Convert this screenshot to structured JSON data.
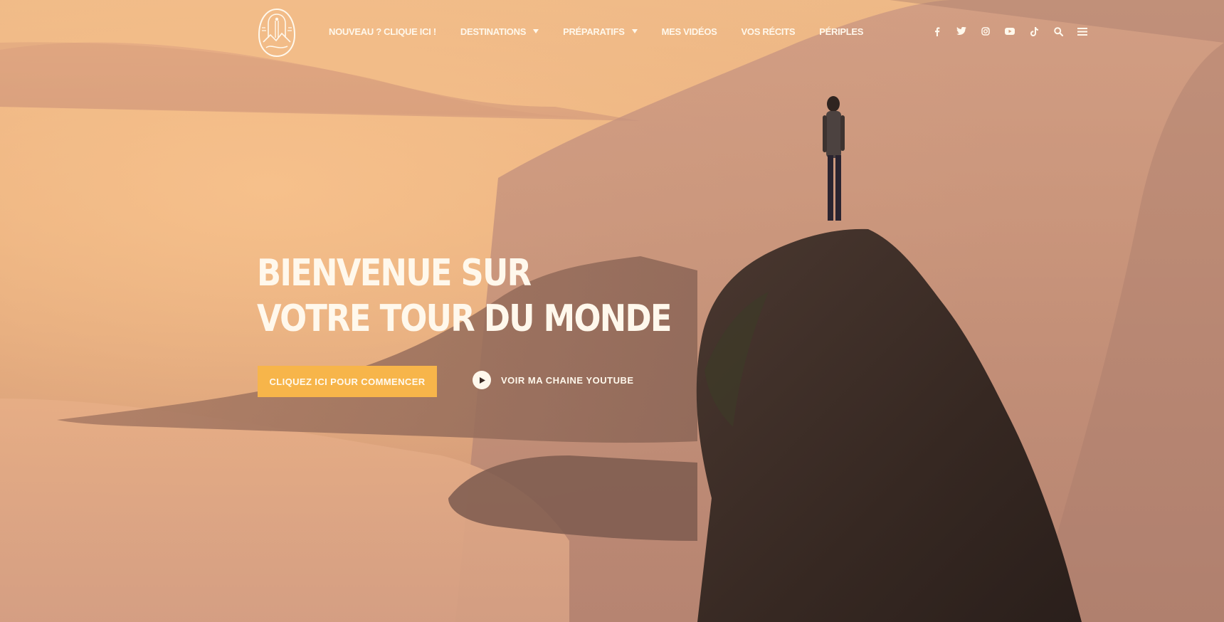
{
  "nav": {
    "items": [
      {
        "label": "NOUVEAU ? CLIQUE ICI !",
        "has_dropdown": false
      },
      {
        "label": "DESTINATIONS",
        "has_dropdown": true
      },
      {
        "label": "PRÉPARATIFS",
        "has_dropdown": true
      },
      {
        "label": "MES VIDÉOS",
        "has_dropdown": false
      },
      {
        "label": "VOS RÉCITS",
        "has_dropdown": false
      },
      {
        "label": "PÉRIPLES",
        "has_dropdown": false
      }
    ]
  },
  "social": {
    "icons": [
      "facebook-icon",
      "twitter-icon",
      "instagram-icon",
      "youtube-icon",
      "tiktok-icon",
      "search-icon",
      "menu-icon"
    ]
  },
  "hero": {
    "title_line1": "BIENVENUE SUR",
    "title_line2": "VOTRE TOUR DU MONDE",
    "cta_label": "CLIQUEZ ICI POUR COMMENCER",
    "youtube_label": "VOIR MA CHAINE YOUTUBE"
  },
  "colors": {
    "accent": "#f7b54a",
    "text": "#fff8ec",
    "sky": "#eeb987",
    "rock": "#3a2a24"
  }
}
